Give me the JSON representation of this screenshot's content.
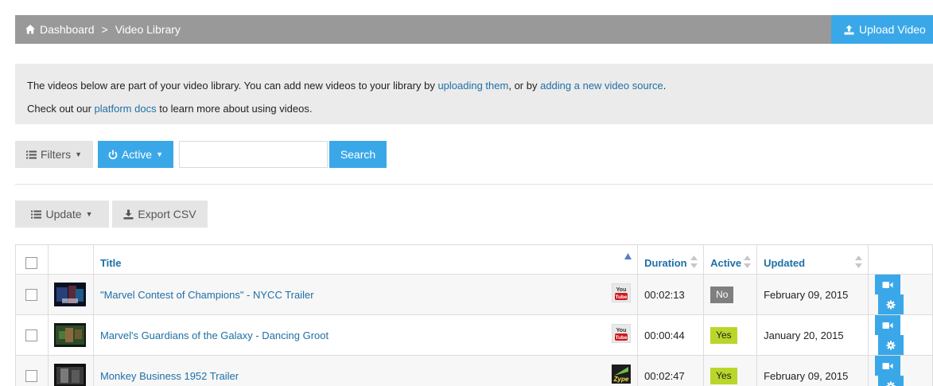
{
  "header": {
    "breadcrumb_home": "Dashboard",
    "breadcrumb_separator": ">",
    "breadcrumb_current": "Video Library",
    "upload_label": "Upload Video"
  },
  "info": {
    "line1_prefix": "The videos below are part of your video library. You can add new videos to your library by ",
    "link_upload": "uploading them",
    "line1_middle": ", or by ",
    "link_source": "adding a new video source",
    "line1_suffix": ".",
    "line2_prefix": "Check out our ",
    "link_docs": "platform docs",
    "line2_suffix": " to learn more about using videos."
  },
  "toolbar": {
    "filters_label": "Filters",
    "active_label": "Active",
    "search_value": "",
    "search_label": "Search",
    "update_label": "Update",
    "export_label": "Export CSV"
  },
  "table": {
    "columns": {
      "title": "Title",
      "duration": "Duration",
      "active": "Active",
      "updated": "Updated"
    },
    "rows": [
      {
        "title": "\"Marvel Contest of Champions\" - NYCC Trailer",
        "source": "youtube-icon",
        "duration": "00:02:13",
        "active": "No",
        "updated": "February 09, 2015",
        "thumb": "thumbnail-marvel-contest"
      },
      {
        "title": "Marvel's Guardians of the Galaxy - Dancing Groot",
        "source": "youtube-icon",
        "duration": "00:00:44",
        "active": "Yes",
        "updated": "January 20, 2015",
        "thumb": "thumbnail-dancing-groot"
      },
      {
        "title": "Monkey Business 1952 Trailer",
        "source": "zype-icon",
        "duration": "00:02:47",
        "active": "Yes",
        "updated": "February 09, 2015",
        "thumb": "thumbnail-monkey-business"
      }
    ]
  },
  "colors": {
    "accent": "#3aa8e8",
    "header_bar": "#999999",
    "link": "#1f6fa6",
    "badge_yes": "#b9d62a",
    "badge_no": "#7f7f7f"
  }
}
